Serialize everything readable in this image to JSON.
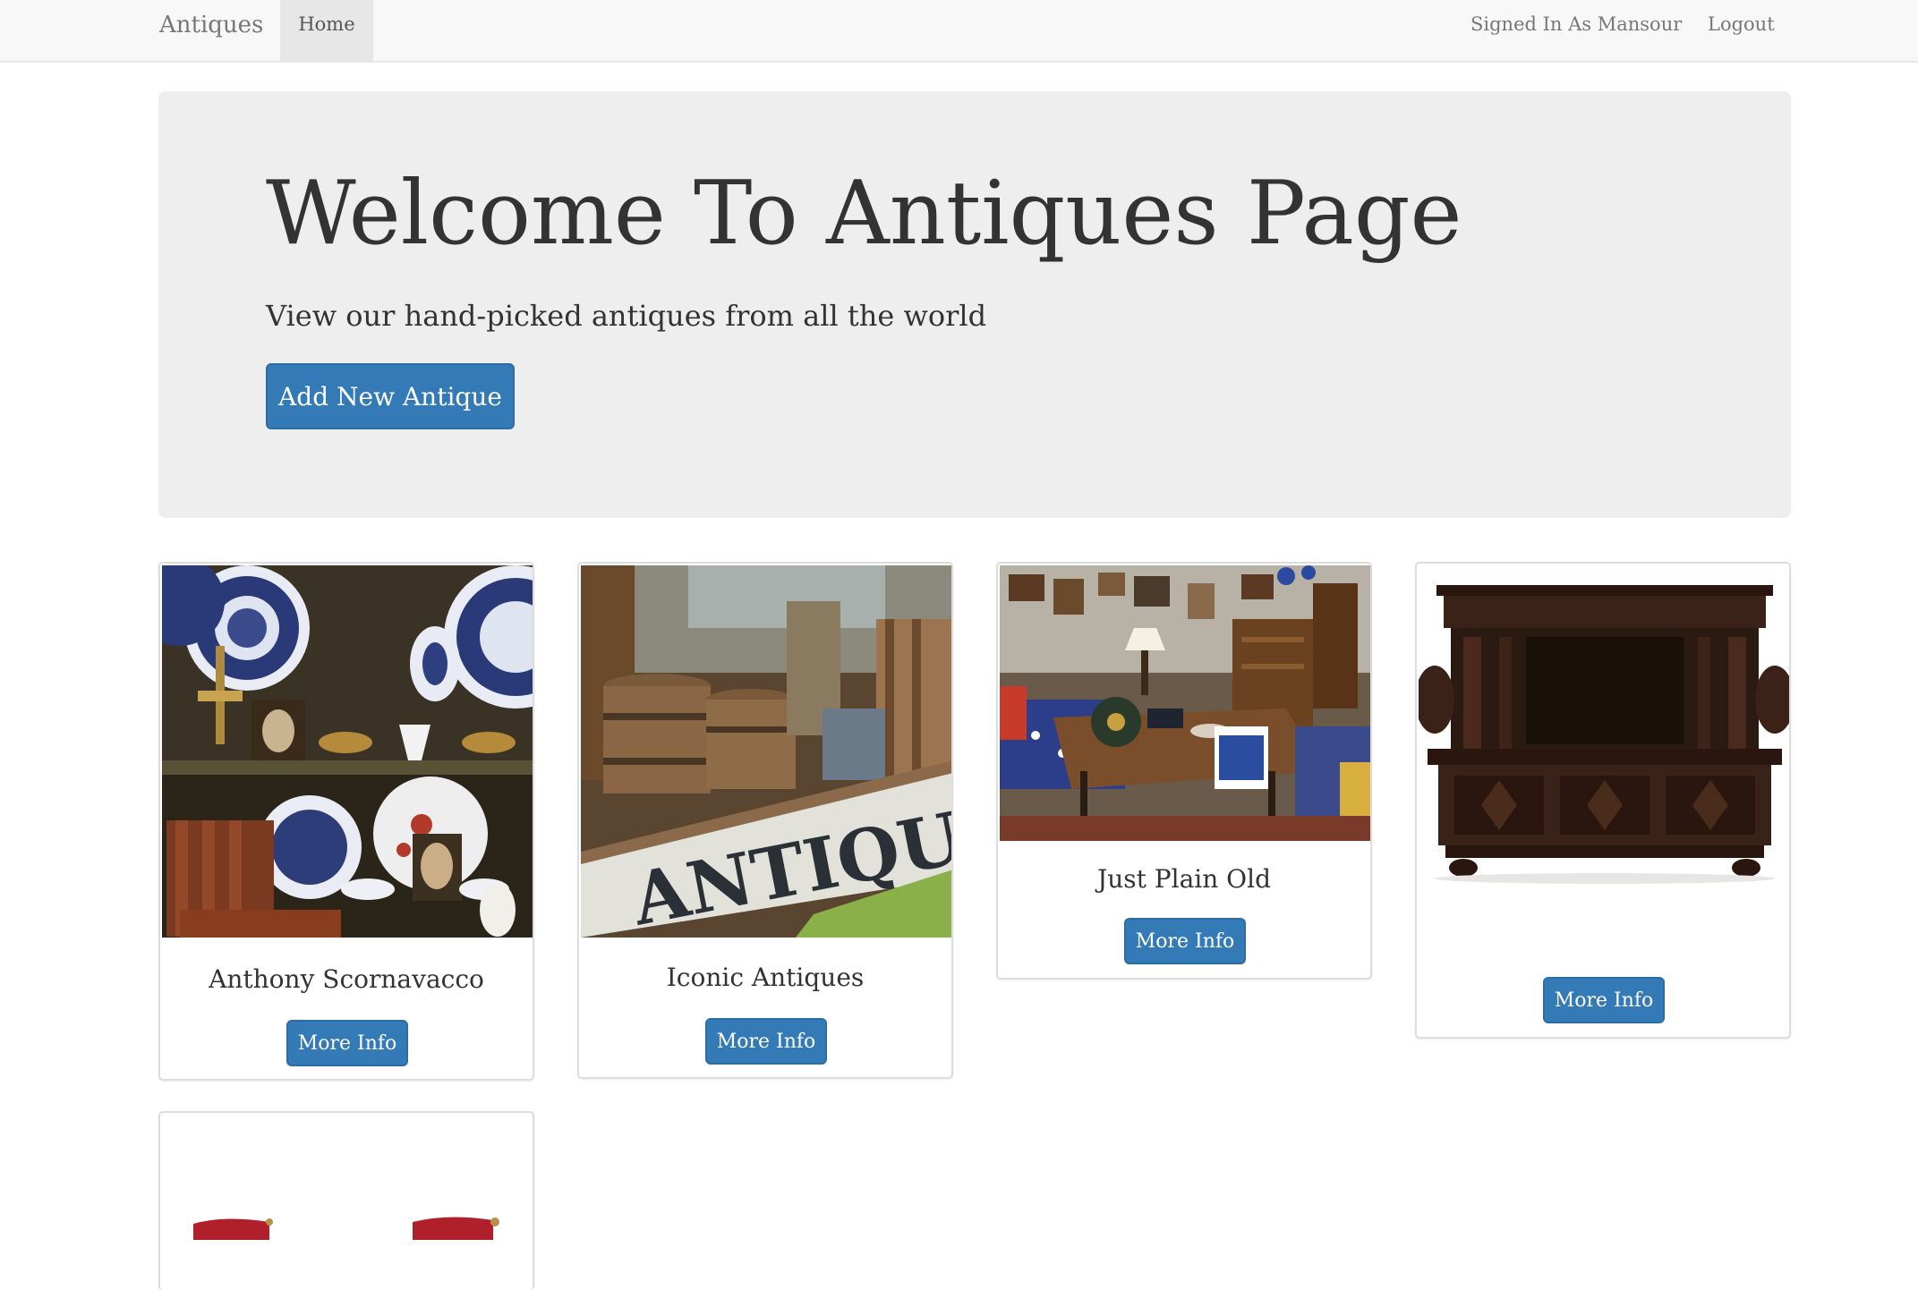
{
  "navbar": {
    "brand": "Antiques",
    "home": "Home",
    "signed_in": "Signed In As Mansour",
    "logout": "Logout"
  },
  "jumbotron": {
    "title": "Welcome To Antiques Page",
    "lead": "View our hand-picked antiques from all the world",
    "add_button": "Add New Antique"
  },
  "cards": [
    {
      "title": "Anthony Scornavacco",
      "button": "More Info"
    },
    {
      "title": "Iconic Antiques",
      "button": "More Info",
      "sign_text": "ANTIQUES"
    },
    {
      "title": "Just Plain Old",
      "button": "More Info"
    },
    {
      "title": "",
      "button": "More Info"
    }
  ],
  "colors": {
    "primary": "#337ab7",
    "jumbotron_bg": "#eeeeee",
    "navbar_bg": "#f8f8f8"
  }
}
